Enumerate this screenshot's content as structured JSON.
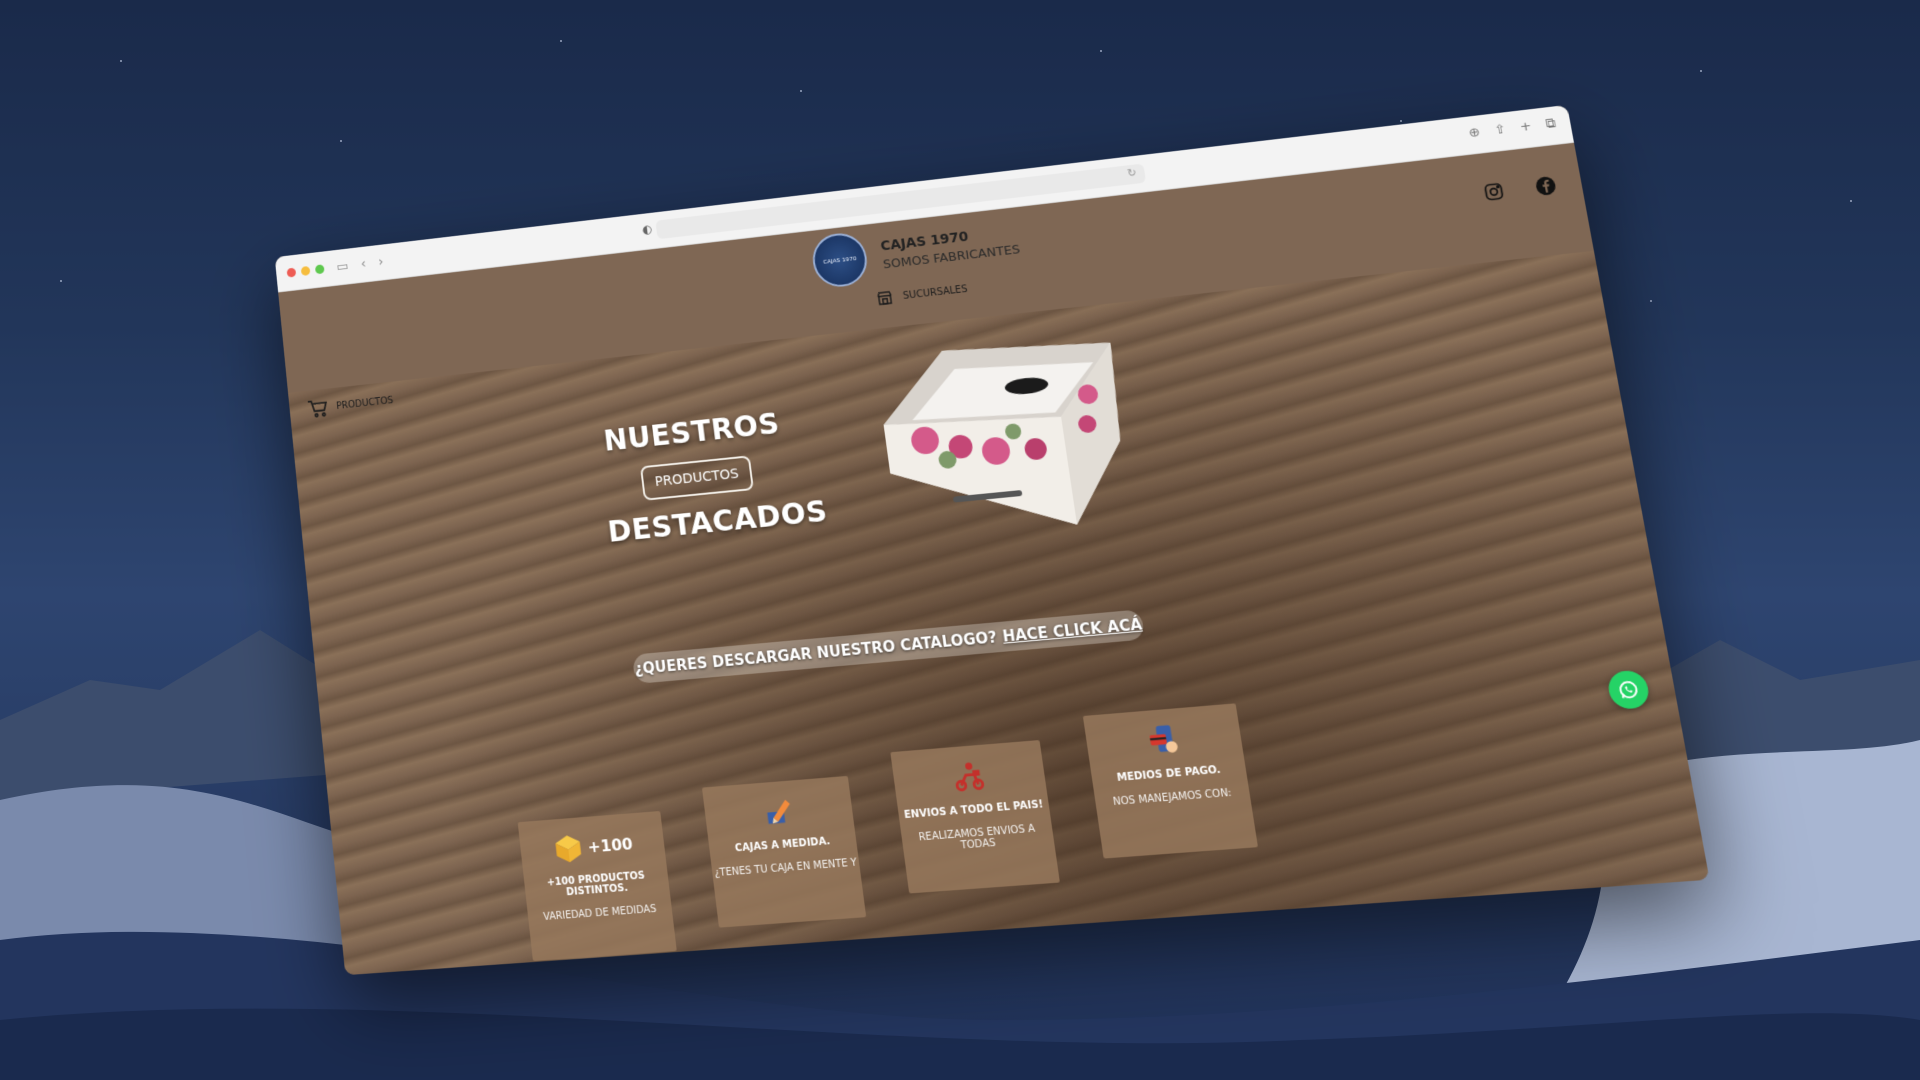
{
  "site": {
    "brand_name": "CAJAS 1970",
    "brand_tagline": "SOMOS FABRICANTES",
    "logo_text": "CAJAS 1970"
  },
  "nav": {
    "sucursales_label": "SUCURSALES",
    "productos_label": "PRODUCTOS"
  },
  "hero": {
    "title_top": "NUESTROS",
    "button_label": "PRODUCTOS",
    "title_bottom": "DESTACADOS"
  },
  "catalog": {
    "question": "¿QUERES DESCARGAR NUESTRO CATALOGO?",
    "link": "HACE CLICK ACÁ"
  },
  "features": [
    {
      "badge": "+100",
      "title": "+100 PRODUCTOS DISTINTOS.",
      "sub": "VARIEDAD DE MEDIDAS",
      "icon": "box-icon"
    },
    {
      "badge": "",
      "title": "CAJAS A MEDIDA.",
      "sub": "¿TENES TU CAJA EN MENTE Y",
      "icon": "pencil-icon"
    },
    {
      "badge": "",
      "title": "ENVIOS A TODO EL PAIS!",
      "sub": "REALIZAMOS ENVIOS A TODAS",
      "icon": "delivery-icon"
    },
    {
      "badge": "",
      "title": "MEDIOS DE PAGO.",
      "sub": "NOS MANEJAMOS CON:",
      "icon": "payment-icon"
    }
  ],
  "colors": {
    "header_bg": "#7f6754",
    "whatsapp": "#25d366",
    "logo_blue": "#1c3766"
  }
}
